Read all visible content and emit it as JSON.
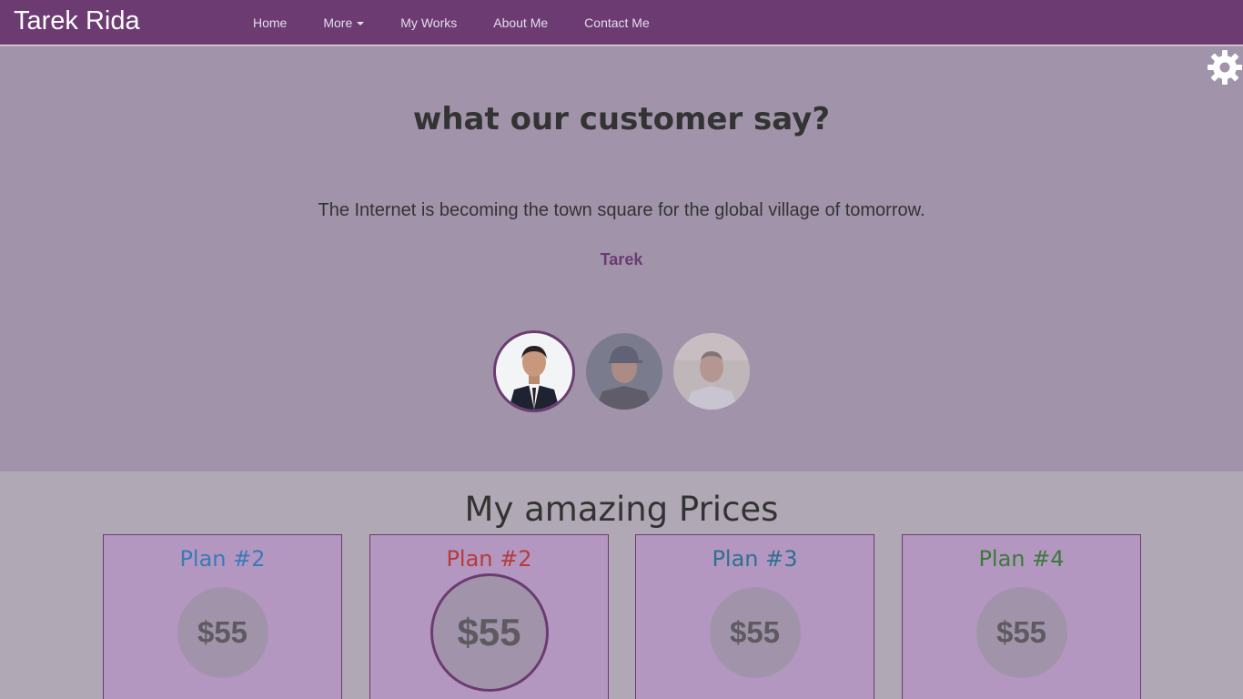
{
  "navbar": {
    "brand": "Tarek Rida",
    "links": [
      "Home",
      "More",
      "My Works",
      "About Me",
      "Contact Me"
    ]
  },
  "testimonials": {
    "title": "what our customer say?",
    "quote": "The Internet is becoming the town square for the global village of tomorrow.",
    "author": "Tarek"
  },
  "pricing": {
    "title": "My amazing Prices",
    "plans": [
      {
        "name": "Plan #2",
        "price": "$55",
        "color": "#3a7ab8"
      },
      {
        "name": "Plan #2",
        "price": "$55",
        "color": "#b53b3b"
      },
      {
        "name": "Plan #3",
        "price": "$55",
        "color": "#2f6f8f"
      },
      {
        "name": "Plan #4",
        "price": "$55",
        "color": "#3b7a3b"
      }
    ]
  },
  "colors": {
    "navbar": "#6c3b72",
    "testimonial_bg": "#a194aa",
    "page_bg": "#b1a8b5",
    "plan_bg": "#b497c0"
  },
  "icons": {
    "settings": "gear-icon",
    "dropdown": "caret-down-icon"
  }
}
